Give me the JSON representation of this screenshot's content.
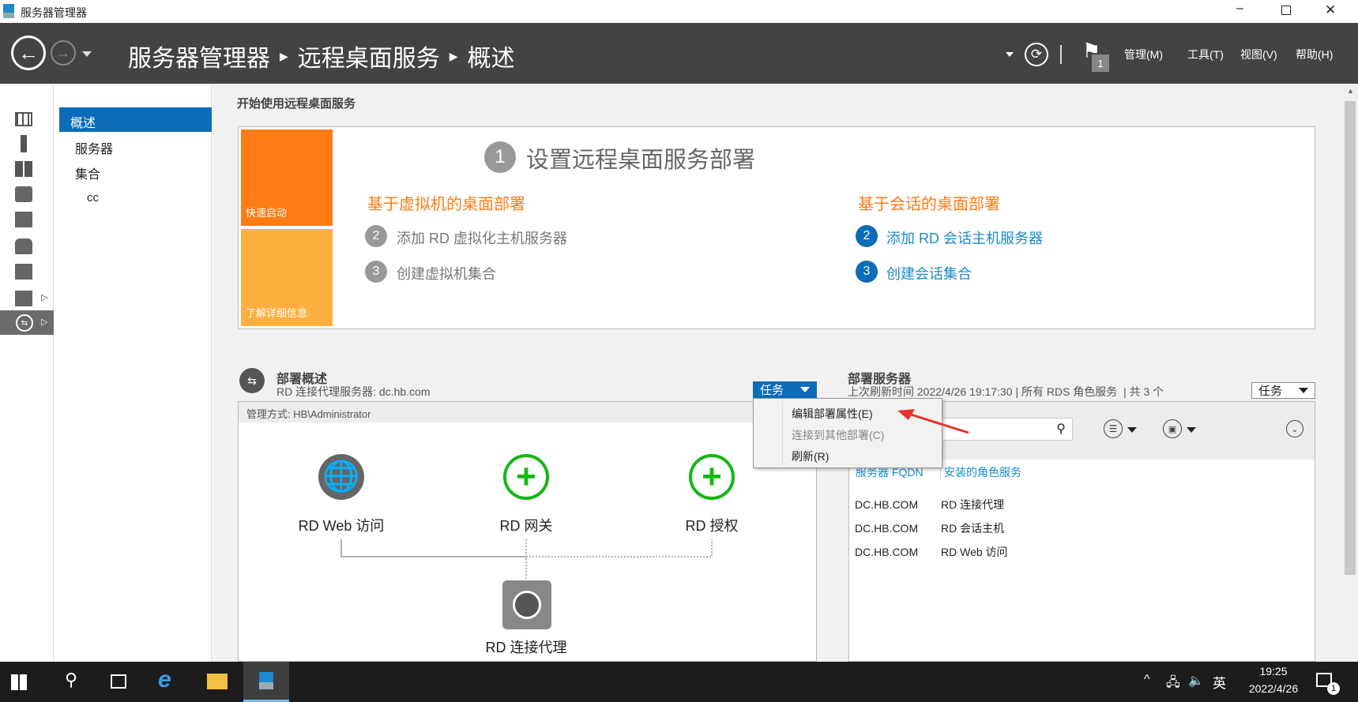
{
  "window": {
    "title": "服务器管理器"
  },
  "header": {
    "breadcrumb": [
      "服务器管理器",
      "远程桌面服务",
      "概述"
    ],
    "flag_count": "1",
    "menus": [
      "管理(M)",
      "工具(T)",
      "视图(V)",
      "帮助(H)"
    ]
  },
  "nav": {
    "items": [
      "概述",
      "服务器",
      "集合"
    ],
    "sub": "cc"
  },
  "quickstart": {
    "section_title": "开始使用远程桌面服务",
    "tile1": "快速启动",
    "tile2": "了解详细信息",
    "step1_num": "1",
    "step1": "设置远程桌面服务部署",
    "vm": {
      "heading": "基于虚拟机的桌面部署",
      "items": [
        {
          "num": "2",
          "label": "添加 RD 虚拟化主机服务器"
        },
        {
          "num": "3",
          "label": "创建虚拟机集合"
        }
      ]
    },
    "session": {
      "heading": "基于会话的桌面部署",
      "items": [
        {
          "num": "2",
          "label": "添加 RD 会话主机服务器"
        },
        {
          "num": "3",
          "label": "创建会话集合"
        }
      ]
    }
  },
  "overview": {
    "title": "部署概述",
    "subtitle": "RD 连接代理服务器: dc.hb.com",
    "tasks": "任务",
    "managed_by": "管理方式: HB\\Administrator",
    "roles": {
      "web": "RD Web 访问",
      "gateway": "RD 网关",
      "license": "RD 授权",
      "broker": "RD 连接代理"
    }
  },
  "menu": {
    "items": [
      "编辑部署属性(E)",
      "连接到其他部署(C)",
      "刷新(R)"
    ]
  },
  "servers": {
    "title": "部署服务器",
    "subtitle": "上次刷新时间 2022/4/26 19:17:30 | 所有 RDS 角色服务  | 共 3 个",
    "tasks": "任务",
    "columns": [
      "服务器 FQDN",
      "安装的角色服务"
    ],
    "rows": [
      [
        "DC.HB.COM",
        "RD 连接代理"
      ],
      [
        "DC.HB.COM",
        "RD 会话主机"
      ],
      [
        "DC.HB.COM",
        "RD Web 访问"
      ]
    ]
  },
  "taskbar": {
    "ime": "英",
    "time": "19:25",
    "date": "2022/4/26",
    "notif_count": "1"
  },
  "colors": {
    "header": "#434343",
    "accent": "#0b6cb8",
    "orange": "#fd7c14",
    "light_orange": "#fdb040"
  }
}
